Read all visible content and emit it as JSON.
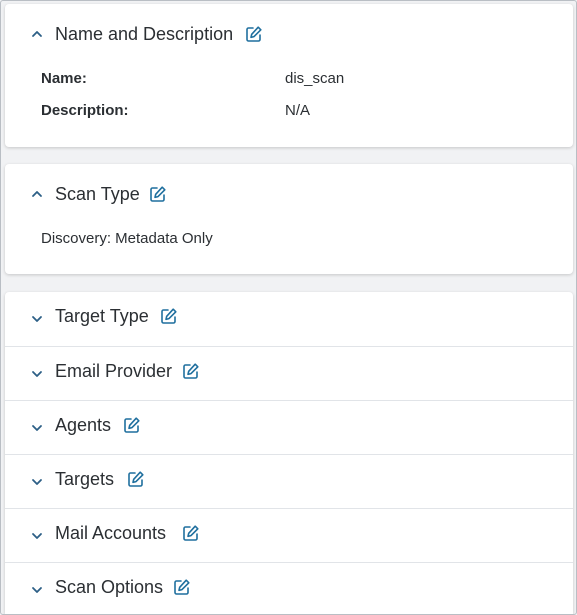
{
  "name_desc": {
    "title": "Name and Description",
    "fields": [
      {
        "label": "Name:",
        "value": "dis_scan"
      },
      {
        "label": "Description:",
        "value": "N/A"
      }
    ]
  },
  "scan_type": {
    "title": "Scan Type",
    "value": "Discovery: Metadata Only"
  },
  "sections": [
    {
      "title": "Target Type"
    },
    {
      "title": "Email Provider"
    },
    {
      "title": "Agents"
    },
    {
      "title": "Targets"
    },
    {
      "title": "Mail Accounts"
    },
    {
      "title": "Scan Options"
    }
  ],
  "colors": {
    "accent": "#1f6f9e",
    "chevron": "#2c5f86"
  },
  "icons": {
    "expand": "chevron-down-icon",
    "collapse": "chevron-up-icon",
    "edit": "edit-icon"
  }
}
